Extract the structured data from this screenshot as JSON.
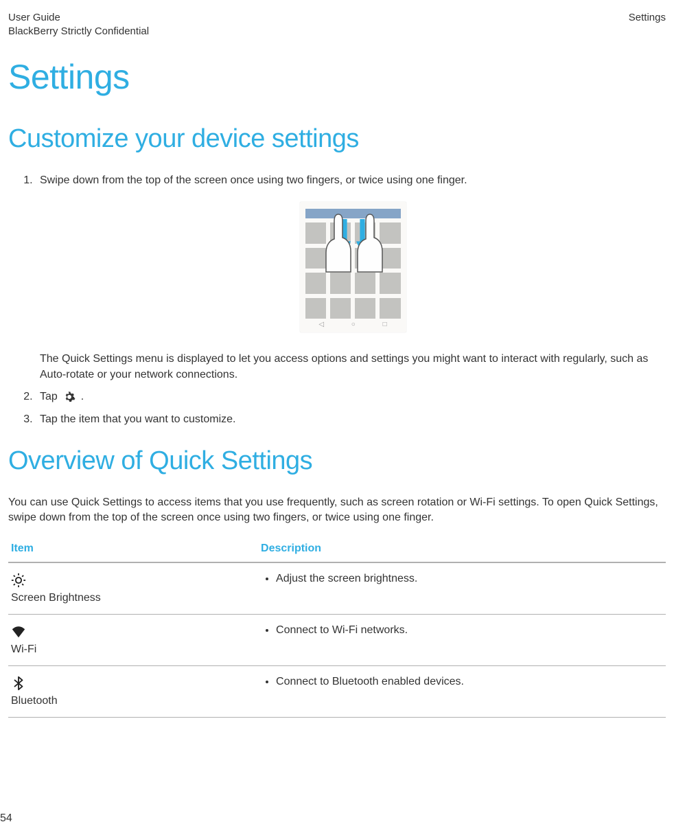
{
  "header": {
    "guide_line1": "User Guide",
    "guide_line2": "BlackBerry Strictly Confidential",
    "right_label": "Settings"
  },
  "page_title": "Settings",
  "section1": {
    "title": "Customize your device settings",
    "steps": {
      "s1": "Swipe down from the top of the screen once using two fingers, or twice using one finger.",
      "s1_post": "The Quick Settings menu is displayed to let you access options and settings you might want to interact with regularly, such as Auto-rotate or your network connections.",
      "s2_prefix": "Tap",
      "s2_suffix": ".",
      "s3": "Tap the item that you want to customize."
    }
  },
  "section2": {
    "title": "Overview of Quick Settings",
    "intro": "You can use Quick Settings to access items that you use frequently, such as screen rotation or Wi-Fi settings. To open Quick Settings, swipe down from the top of the screen once using two fingers, or twice using one finger.",
    "table": {
      "col_item": "Item",
      "col_desc": "Description",
      "rows": [
        {
          "label": "Screen Brightness",
          "desc": "Adjust the screen brightness."
        },
        {
          "label": "Wi-Fi",
          "desc": "Connect to Wi-Fi networks."
        },
        {
          "label": "Bluetooth",
          "desc": "Connect to Bluetooth enabled devices."
        }
      ]
    }
  },
  "page_number": "54"
}
